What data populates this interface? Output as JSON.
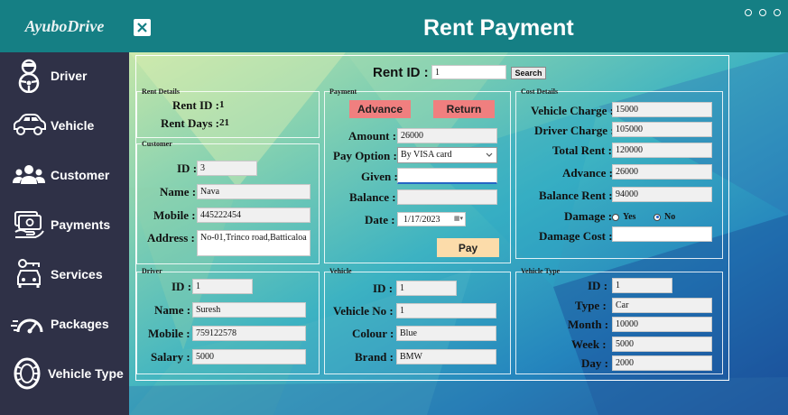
{
  "brand": "AyuboDrive",
  "sidebar": {
    "items": [
      {
        "label": "Driver",
        "icon": "driver-icon"
      },
      {
        "label": "Vehicle",
        "icon": "car-icon"
      },
      {
        "label": "Customer",
        "icon": "customers-icon"
      },
      {
        "label": "Payments",
        "icon": "payments-icon"
      },
      {
        "label": "Services",
        "icon": "services-icon"
      },
      {
        "label": "Packages",
        "icon": "speedometer-icon"
      },
      {
        "label": "Vehicle Type",
        "icon": "tire-icon"
      }
    ]
  },
  "header": {
    "title": "Rent Payment",
    "close": "✕"
  },
  "search": {
    "label": "Rent ID :",
    "value": "1",
    "button": "Search"
  },
  "rent_details": {
    "title": "Rent Details",
    "rent_id_label": "Rent ID :",
    "rent_id": "1",
    "rent_days_label": "Rent Days :",
    "rent_days": "21"
  },
  "customer": {
    "title": "Customer",
    "id_label": "ID :",
    "id": "3",
    "name_label": "Name :",
    "name": "Nava",
    "mobile_label": "Mobile :",
    "mobile": "445222454",
    "address_label": "Address :",
    "address": "No-01,Trinco road,Batticaloa"
  },
  "payment": {
    "title": "Payment",
    "advance_button": "Advance",
    "return_button": "Return",
    "amount_label": "Amount :",
    "amount": "26000",
    "pay_option_label": "Pay Option :",
    "pay_option": "By VISA card",
    "given_label": "Given :",
    "given": "",
    "balance_label": "Balance :",
    "balance": "",
    "date_label": "Date :",
    "date": "1/17/2023",
    "pay_button": "Pay"
  },
  "cost_details": {
    "title": "Cost Details",
    "vehicle_charge_label": "Vehicle Charge :",
    "vehicle_charge": "15000",
    "driver_charge_label": "Driver Charge :",
    "driver_charge": "105000",
    "total_rent_label": "Total Rent :",
    "total_rent": "120000",
    "advance_label": "Advance :",
    "advance": "26000",
    "balance_rent_label": "Balance Rent :",
    "balance_rent": "94000",
    "damage_label": "Damage :",
    "damage_yes": "Yes",
    "damage_no": "No",
    "damage_selected": "No",
    "damage_cost_label": "Damage Cost :",
    "damage_cost": ""
  },
  "driver": {
    "title": "Driver",
    "id_label": "ID :",
    "id": "1",
    "name_label": "Name :",
    "name": "Suresh",
    "mobile_label": "Mobile :",
    "mobile": "759122578",
    "salary_label": "Salary :",
    "salary": "5000"
  },
  "vehicle": {
    "title": "Vehicle",
    "id_label": "ID :",
    "id": "1",
    "vehicle_no_label": "Vehicle No :",
    "vehicle_no": "1",
    "colour_label": "Colour :",
    "colour": "Blue",
    "brand_label": "Brand :",
    "brand": "BMW"
  },
  "vehicle_type": {
    "title": "Vehicle Type",
    "id_label": "ID :",
    "id": "1",
    "type_label": "Type :",
    "type": "Car",
    "month_label": "Month :",
    "month": "10000",
    "week_label": "Week :",
    "week": "5000",
    "day_label": "Day :",
    "day": "2000"
  },
  "colors": {
    "teal": "#157f84",
    "sidebar": "#2f3147",
    "button_red": "#f07f7f",
    "pay_button": "#fcdcaa"
  }
}
